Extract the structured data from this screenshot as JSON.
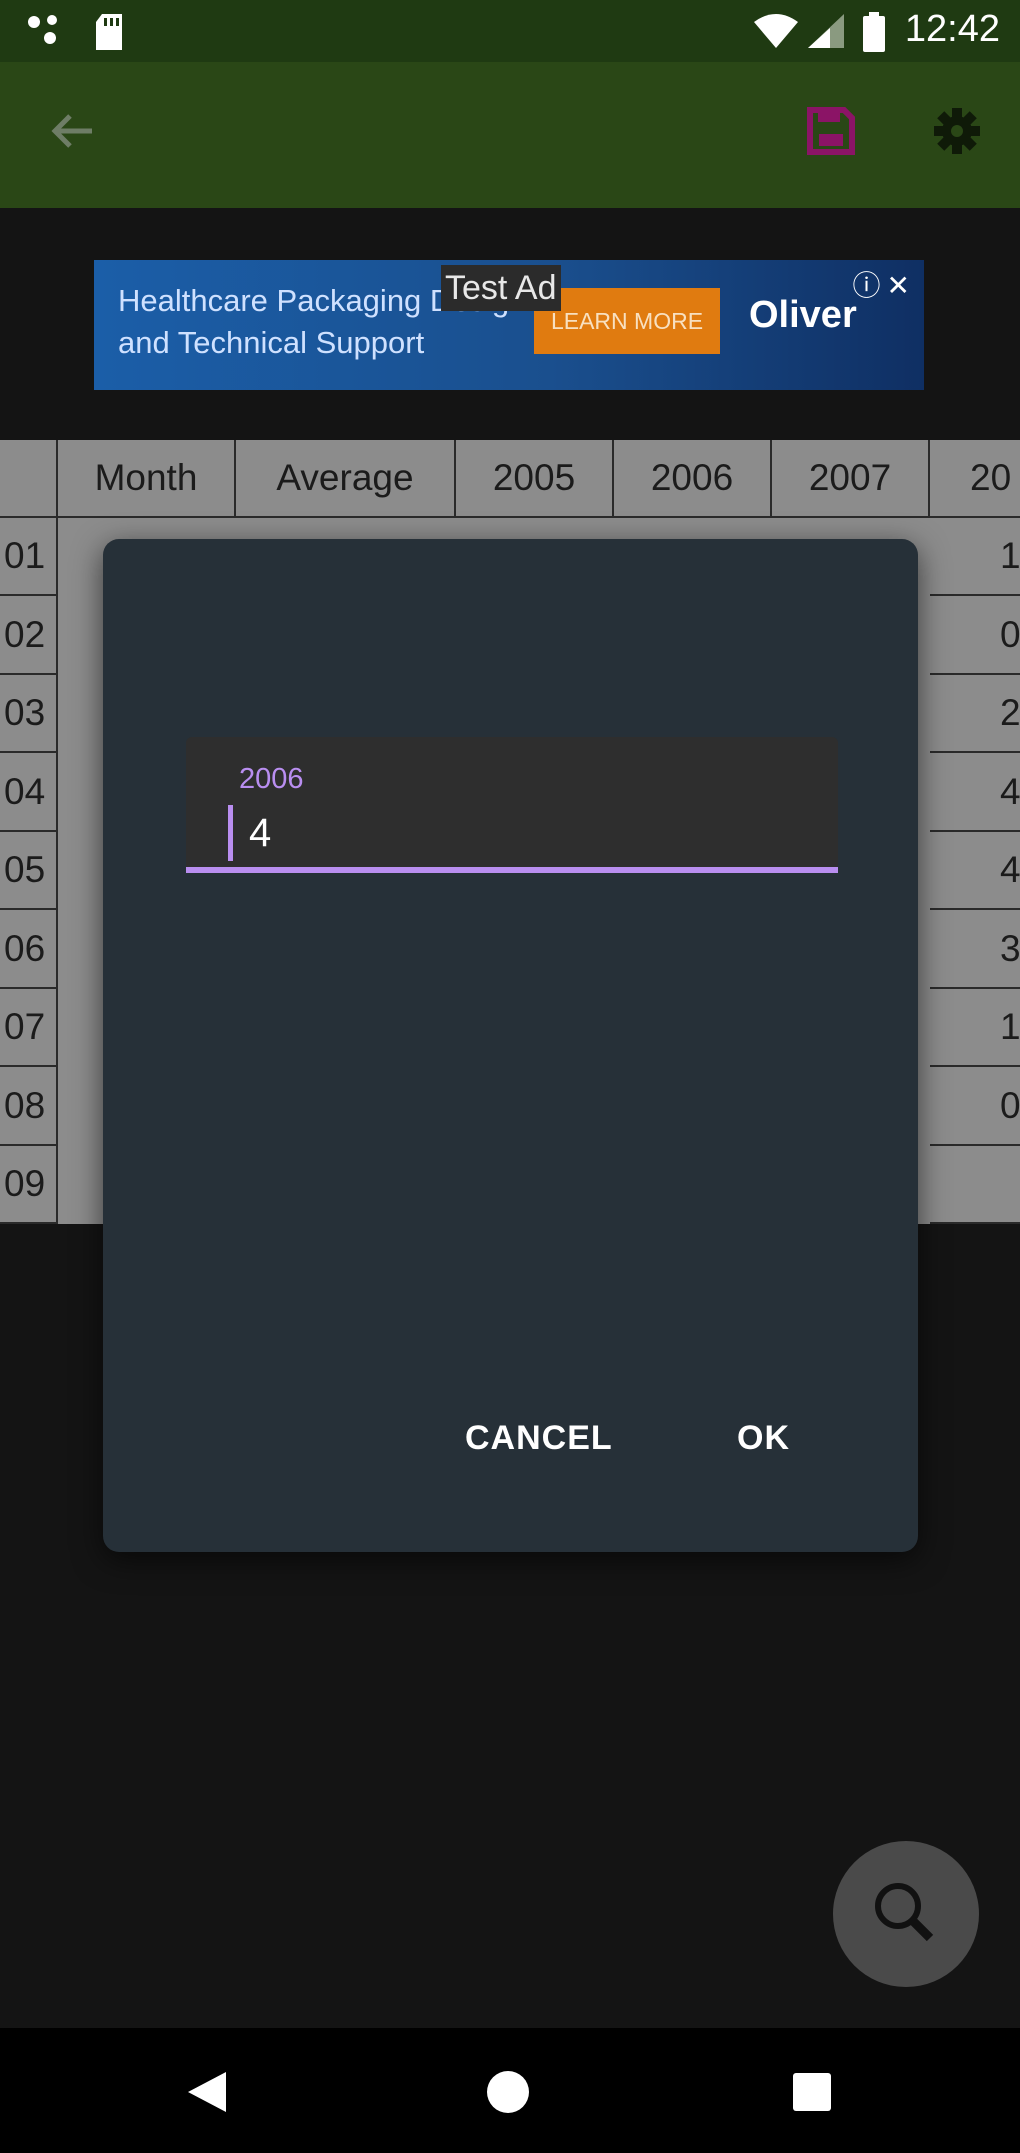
{
  "status_bar": {
    "time": "12:42",
    "left_icons": [
      "notification-dots-icon",
      "sd-card-icon"
    ],
    "right_icons": [
      "wifi-icon",
      "cell-signal-icon",
      "battery-icon"
    ]
  },
  "toolbar": {
    "back_icon": "arrow-left-icon",
    "save_icon": "save-icon",
    "settings_icon": "gear-icon",
    "save_color": "#8b1466"
  },
  "ad": {
    "label": "Test Ad",
    "headline": "Healthcare Packaging Design and Technical Support",
    "cta": "LEARN MORE",
    "brand": "Oliver",
    "info_icons": "ⓘ✕"
  },
  "table": {
    "columns": [
      "Month",
      "Average",
      "2005",
      "2006",
      "2007",
      "20"
    ],
    "row_labels": [
      "01",
      "02",
      "03",
      "04",
      "05",
      "06",
      "07",
      "08",
      "09"
    ],
    "last_column_values": [
      "1",
      "0",
      "2",
      "4",
      "4",
      "3",
      "1",
      "0",
      ""
    ]
  },
  "dialog": {
    "field_label": "2006",
    "field_value": "4",
    "cancel_label": "CANCEL",
    "ok_label": "OK",
    "accent": "#b98ef0"
  },
  "fab": {
    "icon": "search-icon"
  },
  "nav_bar": {
    "icons": [
      "back-triangle-icon",
      "home-circle-icon",
      "recents-square-icon"
    ]
  }
}
